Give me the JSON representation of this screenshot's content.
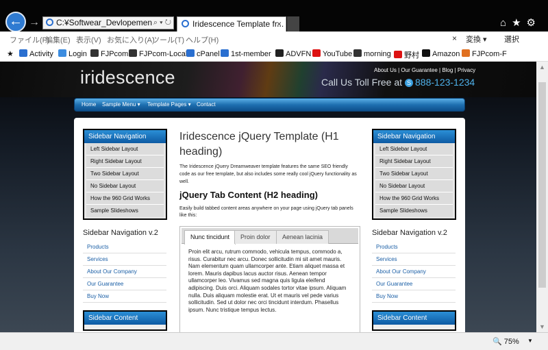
{
  "browser": {
    "address": "C:¥Softwear_Devlopement¥",
    "tab_title": "Iridescence Template fr...",
    "tab_close": "×",
    "back": "←",
    "forward": "→",
    "addr_tools": "⌕ ▾ ↻",
    "window_icons": "⌂★⚙",
    "menu": [
      "ファイル(F)",
      "編集(E)",
      "表示(V)",
      "お気に入り(A)",
      "ツール(T)",
      "ヘルプ(H)"
    ],
    "menu_close": "×",
    "convert": "変換 ▾",
    "select": "選択",
    "favorites": [
      {
        "label": "Activity",
        "color": "#2a6fd0"
      },
      {
        "label": "Login",
        "color": "#3c8de0"
      },
      {
        "label": "FJPcom",
        "color": "#333333"
      },
      {
        "label": "FJPcom-Local",
        "color": "#333333"
      },
      {
        "label": "cPanel",
        "color": "#2a6fd0"
      },
      {
        "label": "1st-member",
        "color": "#2a6fd0"
      },
      {
        "label": "ADVFN",
        "color": "#222222"
      },
      {
        "label": "YouTube",
        "color": "#d11"
      },
      {
        "label": "morning",
        "color": "#333333"
      },
      {
        "label": "野村",
        "color": "#d11"
      },
      {
        "label": "Amazon",
        "color": "#111111"
      },
      {
        "label": "FJPcom-F",
        "color": "#e07020"
      }
    ],
    "zoom": "75%",
    "zoom_arrow": "▼"
  },
  "site": {
    "logo": "iridescence",
    "top_links": "About Us | Our Guarantee | Blog | Privacy",
    "toll_free": "Call Us Toll Free at",
    "phone": "888-123-1234",
    "nav": [
      "Home",
      "Sample Menu ▾",
      "Template Pages ▾",
      "Contact"
    ],
    "sidebar_title": "Sidebar Navigation",
    "sidebar_items": [
      "Left Sidebar Layout",
      "Right Sidebar Layout",
      "Two Sidebar Layout",
      "No Sidebar Layout",
      "How the 960 Grid Works",
      "Sample Slideshows"
    ],
    "nav2_title": "Sidebar Navigation v.2",
    "nav2_items": [
      "Products",
      "Services",
      "About Our Company",
      "Our Guarantee",
      "Buy Now"
    ],
    "sidebar_content_title": "Sidebar Content",
    "h1": "Iridescence jQuery Template (H1 heading)",
    "intro": "The Iridescence jQuery Dreamweaver template features the same SEO friendly code as our free template, but also includes some really cool jQuery functionality as well.",
    "h2": "jQuery Tab Content (H2 heading)",
    "intro2": "Easily build tabbed content areas anywhere on your page using jQuery tab panels like this:",
    "tabs": [
      "Nunc tincidunt",
      "Proin dolor",
      "Aenean lacinia"
    ],
    "tab_body": "Proin elit arcu, rutrum commodo, vehicula tempus, commodo a, risus. Curabitur nec arcu. Donec sollicitudin mi sit amet mauris. Nam elementum quam ullamcorper ante. Etiam aliquet massa et lorem. Mauris dapibus lacus auctor risus. Aenean tempor ullamcorper leo. Vivamus sed magna quis ligula eleifend adipiscing. Duis orci. Aliquam sodales tortor vitae ipsum. Aliquam nulla. Duis aliquam molestie erat. Ut et mauris vel pede varius sollicitudin. Sed ut dolor nec orci tincidunt interdum. Phasellus ipsum. Nunc tristique tempus lectus."
  }
}
